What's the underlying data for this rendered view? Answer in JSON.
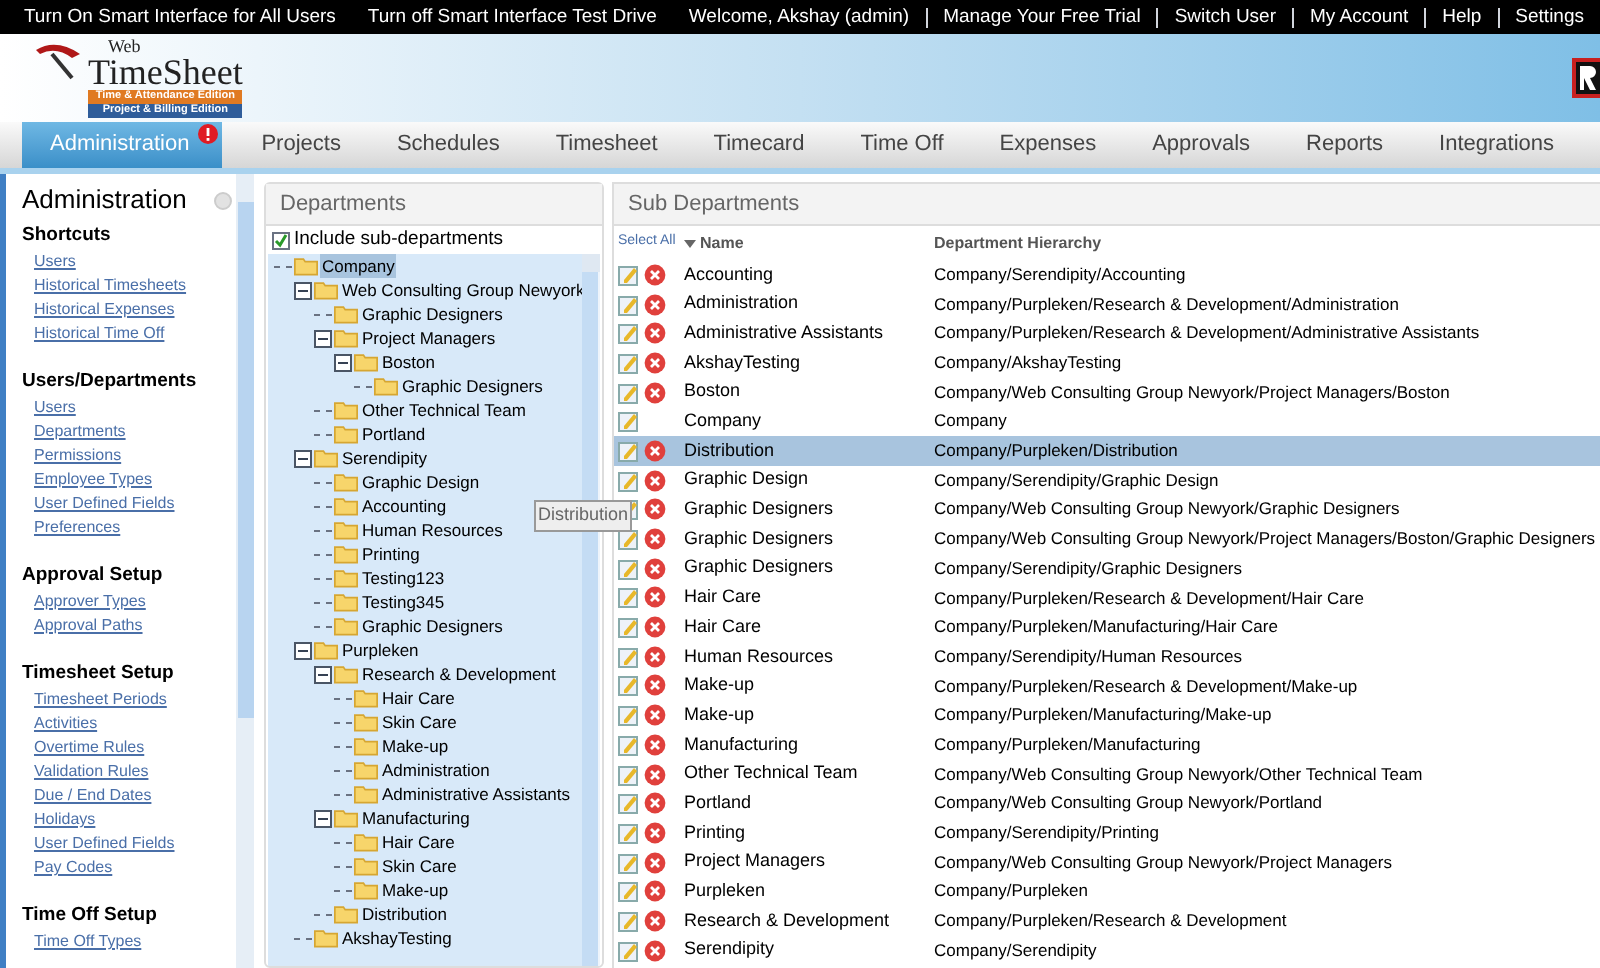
{
  "top_bar": {
    "links": [
      "Turn On Smart Interface for All Users",
      "Turn off Smart Interface Test Drive",
      "Welcome, Akshay (admin)",
      "Manage Your Free Trial",
      "Switch User",
      "My Account",
      "Help",
      "Settings"
    ]
  },
  "logo": {
    "small": "Web",
    "name": "TimeSheet",
    "editions": [
      "Time & Attendance Edition",
      "Project & Billing Edition"
    ]
  },
  "nav_tabs": [
    {
      "label": "Administration",
      "selected": true,
      "alert": true
    },
    {
      "label": "Projects",
      "selected": false,
      "alert": false
    },
    {
      "label": "Schedules",
      "selected": false,
      "alert": false
    },
    {
      "label": "Timesheet",
      "selected": false,
      "alert": false
    },
    {
      "label": "Timecard",
      "selected": false,
      "alert": false
    },
    {
      "label": "Time Off",
      "selected": false,
      "alert": false
    },
    {
      "label": "Expenses",
      "selected": false,
      "alert": false
    },
    {
      "label": "Approvals",
      "selected": false,
      "alert": false
    },
    {
      "label": "Reports",
      "selected": false,
      "alert": false
    },
    {
      "label": "Integrations",
      "selected": false,
      "alert": false
    }
  ],
  "sidebar": {
    "title": "Administration",
    "sections": [
      {
        "title": "Shortcuts",
        "links": [
          "Users",
          "Historical Timesheets",
          "Historical Expenses",
          "Historical Time Off"
        ]
      },
      {
        "title": "Users/Departments",
        "links": [
          "Users",
          "Departments",
          "Permissions",
          "Employee Types",
          "User Defined Fields",
          "Preferences"
        ]
      },
      {
        "title": "Approval Setup",
        "links": [
          "Approver Types",
          "Approval Paths"
        ]
      },
      {
        "title": "Timesheet Setup",
        "links": [
          "Timesheet Periods",
          "Activities",
          "Overtime Rules",
          "Validation Rules",
          "Due / End Dates",
          "Holidays",
          "User Defined Fields",
          "Pay Codes"
        ]
      },
      {
        "title": "Time Off Setup",
        "links": [
          "Time Off Types"
        ]
      }
    ]
  },
  "departments": {
    "title": "Departments",
    "include_sub": {
      "label": "Include sub-departments",
      "checked": true
    },
    "tree": [
      {
        "label": "Company",
        "selected": true,
        "children": [
          {
            "label": "Web Consulting Group Newyork",
            "selected": false,
            "expanded": true,
            "children": [
              {
                "label": "Graphic Designers",
                "selected": false
              },
              {
                "label": "Project Managers",
                "selected": false,
                "expanded": true,
                "children": [
                  {
                    "label": "Boston",
                    "selected": false,
                    "expanded": true,
                    "children": [
                      {
                        "label": "Graphic Designers",
                        "selected": false
                      }
                    ]
                  }
                ]
              },
              {
                "label": "Other Technical Team",
                "selected": false
              },
              {
                "label": "Portland",
                "selected": false
              }
            ]
          },
          {
            "label": "Serendipity",
            "selected": false,
            "expanded": true,
            "children": [
              {
                "label": "Graphic Design",
                "selected": false
              },
              {
                "label": "Accounting",
                "selected": false
              },
              {
                "label": "Human Resources",
                "selected": false
              },
              {
                "label": "Printing",
                "selected": false
              },
              {
                "label": "Testing123",
                "selected": false
              },
              {
                "label": "Testing345",
                "selected": false
              },
              {
                "label": "Graphic Designers",
                "selected": false
              }
            ]
          },
          {
            "label": "Purpleken",
            "selected": false,
            "expanded": true,
            "children": [
              {
                "label": "Research & Development",
                "selected": false,
                "expanded": true,
                "children": [
                  {
                    "label": "Hair Care",
                    "selected": false
                  },
                  {
                    "label": "Skin Care",
                    "selected": false
                  },
                  {
                    "label": "Make-up",
                    "selected": false
                  },
                  {
                    "label": "Administration",
                    "selected": false
                  },
                  {
                    "label": "Administrative Assistants",
                    "selected": false
                  }
                ]
              },
              {
                "label": "Manufacturing",
                "selected": false,
                "expanded": true,
                "children": [
                  {
                    "label": "Hair Care",
                    "selected": false
                  },
                  {
                    "label": "Skin Care",
                    "selected": false
                  },
                  {
                    "label": "Make-up",
                    "selected": false
                  }
                ]
              },
              {
                "label": "Distribution",
                "selected": false
              }
            ]
          },
          {
            "label": "AkshayTesting",
            "selected": false
          }
        ]
      }
    ],
    "tooltip": "Distribution"
  },
  "sub_departments": {
    "title": "Sub Departments",
    "columns": [
      "Select All",
      "Name",
      "Department Hierarchy"
    ],
    "rows": [
      {
        "name": "Accounting",
        "hierarchy": "Company/Serendipity/Accounting",
        "deletable": true,
        "selected": false
      },
      {
        "name": "Administration",
        "hierarchy": "Company/Purpleken/Research & Development/Administration",
        "deletable": true,
        "selected": false
      },
      {
        "name": "Administrative Assistants",
        "hierarchy": "Company/Purpleken/Research & Development/Administrative Assistants",
        "deletable": true,
        "selected": false
      },
      {
        "name": "AkshayTesting",
        "hierarchy": "Company/AkshayTesting",
        "deletable": true,
        "selected": false
      },
      {
        "name": "Boston",
        "hierarchy": "Company/Web Consulting Group Newyork/Project Managers/Boston",
        "deletable": true,
        "selected": false
      },
      {
        "name": "Company",
        "hierarchy": "Company",
        "deletable": false,
        "selected": false
      },
      {
        "name": "Distribution",
        "hierarchy": "Company/Purpleken/Distribution",
        "deletable": true,
        "selected": true
      },
      {
        "name": "Graphic Design",
        "hierarchy": "Company/Serendipity/Graphic Design",
        "deletable": true,
        "selected": false
      },
      {
        "name": "Graphic Designers",
        "hierarchy": "Company/Web Consulting Group Newyork/Graphic Designers",
        "deletable": true,
        "selected": false
      },
      {
        "name": "Graphic Designers",
        "hierarchy": "Company/Web Consulting Group Newyork/Project Managers/Boston/Graphic Designers",
        "deletable": true,
        "selected": false
      },
      {
        "name": "Graphic Designers",
        "hierarchy": "Company/Serendipity/Graphic Designers",
        "deletable": true,
        "selected": false
      },
      {
        "name": "Hair Care",
        "hierarchy": "Company/Purpleken/Research & Development/Hair Care",
        "deletable": true,
        "selected": false
      },
      {
        "name": "Hair Care",
        "hierarchy": "Company/Purpleken/Manufacturing/Hair Care",
        "deletable": true,
        "selected": false
      },
      {
        "name": "Human Resources",
        "hierarchy": "Company/Serendipity/Human Resources",
        "deletable": true,
        "selected": false
      },
      {
        "name": "Make-up",
        "hierarchy": "Company/Purpleken/Research & Development/Make-up",
        "deletable": true,
        "selected": false
      },
      {
        "name": "Make-up",
        "hierarchy": "Company/Purpleken/Manufacturing/Make-up",
        "deletable": true,
        "selected": false
      },
      {
        "name": "Manufacturing",
        "hierarchy": "Company/Purpleken/Manufacturing",
        "deletable": true,
        "selected": false
      },
      {
        "name": "Other Technical Team",
        "hierarchy": "Company/Web Consulting Group Newyork/Other Technical Team",
        "deletable": true,
        "selected": false
      },
      {
        "name": "Portland",
        "hierarchy": "Company/Web Consulting Group Newyork/Portland",
        "deletable": true,
        "selected": false
      },
      {
        "name": "Printing",
        "hierarchy": "Company/Serendipity/Printing",
        "deletable": true,
        "selected": false
      },
      {
        "name": "Project Managers",
        "hierarchy": "Company/Web Consulting Group Newyork/Project Managers",
        "deletable": true,
        "selected": false
      },
      {
        "name": "Purpleken",
        "hierarchy": "Company/Purpleken",
        "deletable": true,
        "selected": false
      },
      {
        "name": "Research & Development",
        "hierarchy": "Company/Purpleken/Research & Development",
        "deletable": true,
        "selected": false
      },
      {
        "name": "Serendipity",
        "hierarchy": "Company/Serendipity",
        "deletable": true,
        "selected": false
      }
    ]
  }
}
